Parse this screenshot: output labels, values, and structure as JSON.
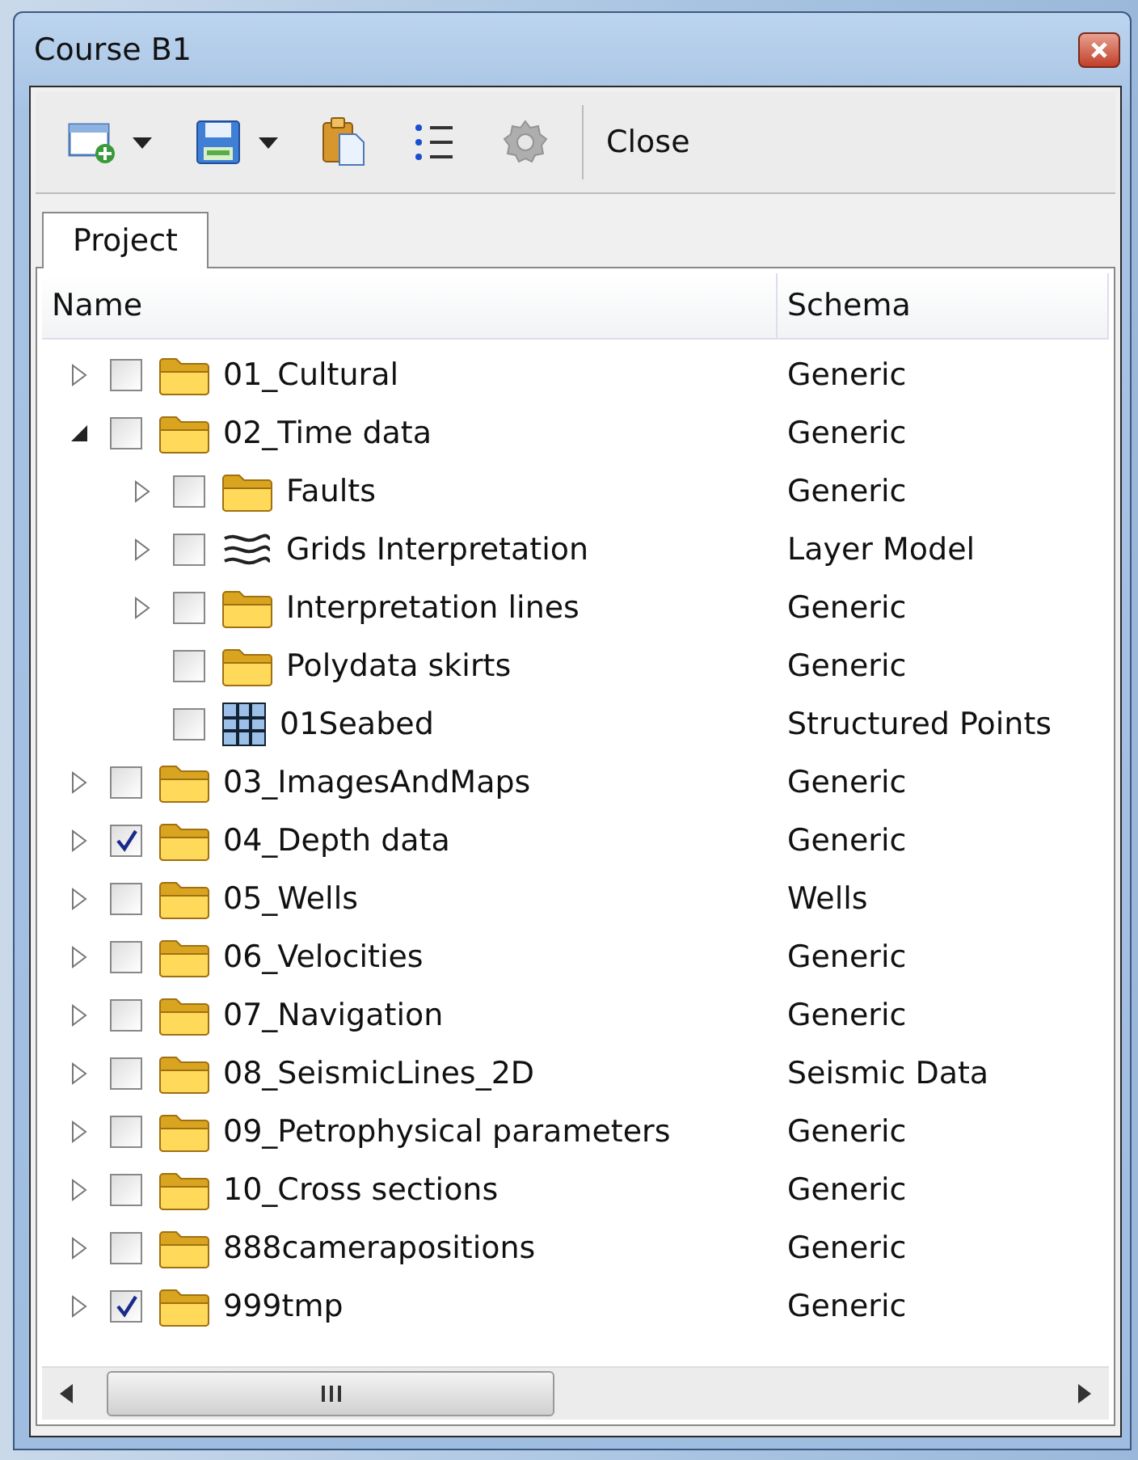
{
  "window": {
    "title": "Course B1"
  },
  "toolbar": [
    {
      "kind": "new-window",
      "dropdown": true,
      "disabled": false
    },
    {
      "kind": "save",
      "dropdown": true,
      "disabled": false
    },
    {
      "kind": "paste",
      "dropdown": false,
      "disabled": false
    },
    {
      "kind": "list",
      "dropdown": false,
      "disabled": false
    },
    {
      "kind": "gear",
      "dropdown": false,
      "disabled": true
    },
    {
      "kind": "separator"
    },
    {
      "kind": "text",
      "label": "Close"
    }
  ],
  "tabs": [
    {
      "label": "Project",
      "selected": true
    }
  ],
  "tree": {
    "columns": [
      "Name",
      "Schema"
    ],
    "items": [
      {
        "name": "01_Cultural",
        "schema": "Generic",
        "kind": "folder",
        "checked": false,
        "expandable": true,
        "expanded": false
      },
      {
        "name": "02_Time data",
        "schema": "Generic",
        "kind": "folder",
        "checked": false,
        "expandable": true,
        "expanded": true,
        "children": [
          {
            "name": "Faults",
            "schema": "Generic",
            "kind": "folder",
            "checked": false,
            "expandable": true,
            "expanded": false
          },
          {
            "name": "Grids Interpretation",
            "schema": "Layer Model",
            "kind": "layers",
            "checked": false,
            "expandable": true,
            "expanded": false
          },
          {
            "name": "Interpretation lines",
            "schema": "Generic",
            "kind": "folder",
            "checked": false,
            "expandable": true,
            "expanded": false
          },
          {
            "name": "Polydata skirts",
            "schema": "Generic",
            "kind": "folder",
            "checked": false,
            "expandable": false
          },
          {
            "name": "01Seabed",
            "schema": "Structured Points",
            "kind": "grid",
            "checked": false,
            "expandable": false
          }
        ]
      },
      {
        "name": "03_ImagesAndMaps",
        "schema": "Generic",
        "kind": "folder",
        "checked": false,
        "expandable": true,
        "expanded": false
      },
      {
        "name": "04_Depth data",
        "schema": "Generic",
        "kind": "folder",
        "checked": true,
        "expandable": true,
        "expanded": false
      },
      {
        "name": "05_Wells",
        "schema": "Wells",
        "kind": "folder",
        "checked": false,
        "expandable": true,
        "expanded": false
      },
      {
        "name": "06_Velocities",
        "schema": "Generic",
        "kind": "folder",
        "checked": false,
        "expandable": true,
        "expanded": false
      },
      {
        "name": "07_Navigation",
        "schema": "Generic",
        "kind": "folder",
        "checked": false,
        "expandable": true,
        "expanded": false
      },
      {
        "name": "08_SeismicLines_2D",
        "schema": "Seismic Data",
        "kind": "folder",
        "checked": false,
        "expandable": true,
        "expanded": false
      },
      {
        "name": "09_Petrophysical parameters",
        "schema": "Generic",
        "kind": "folder",
        "checked": false,
        "expandable": true,
        "expanded": false
      },
      {
        "name": "10_Cross sections",
        "schema": "Generic",
        "kind": "folder",
        "checked": false,
        "expandable": true,
        "expanded": false
      },
      {
        "name": "888camerapositions",
        "schema": "Generic",
        "kind": "folder",
        "checked": false,
        "expandable": true,
        "expanded": false
      },
      {
        "name": "999tmp",
        "schema": "Generic",
        "kind": "folder",
        "checked": true,
        "expandable": true,
        "expanded": false
      }
    ]
  }
}
